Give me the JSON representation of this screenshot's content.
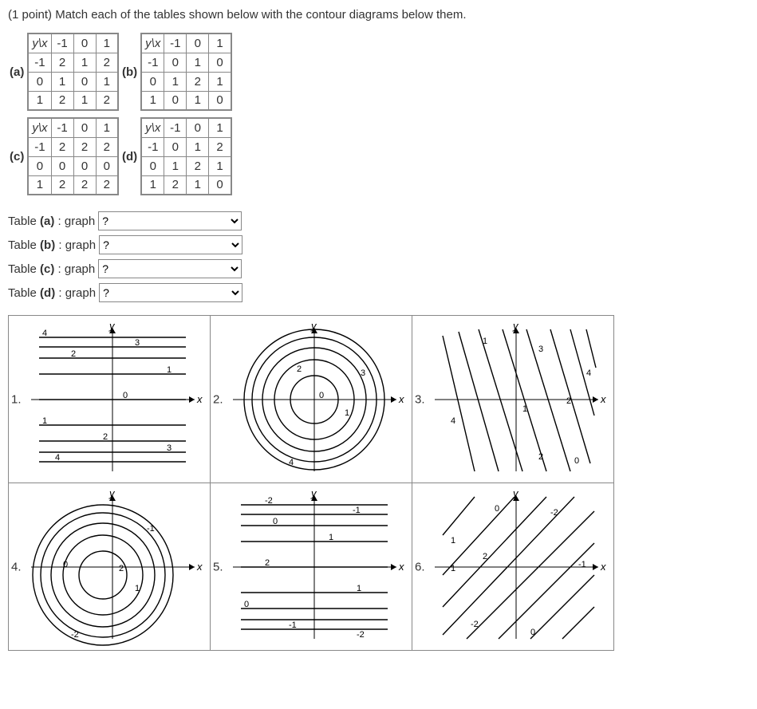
{
  "prompt_prefix": "(1 point) ",
  "prompt_body": "Match each of the tables shown below with the contour diagrams below them.",
  "yx": "y\\x",
  "tables": {
    "a": {
      "label": "(a)",
      "header": [
        "-1",
        "0",
        "1"
      ],
      "rows": [
        [
          "-1",
          "2",
          "1",
          "2"
        ],
        [
          "0",
          "1",
          "0",
          "1"
        ],
        [
          "1",
          "2",
          "1",
          "2"
        ]
      ]
    },
    "b": {
      "label": "(b)",
      "header": [
        "-1",
        "0",
        "1"
      ],
      "rows": [
        [
          "-1",
          "0",
          "1",
          "0"
        ],
        [
          "0",
          "1",
          "2",
          "1"
        ],
        [
          "1",
          "0",
          "1",
          "0"
        ]
      ]
    },
    "c": {
      "label": "(c)",
      "header": [
        "-1",
        "0",
        "1"
      ],
      "rows": [
        [
          "-1",
          "2",
          "2",
          "2"
        ],
        [
          "0",
          "0",
          "0",
          "0"
        ],
        [
          "1",
          "2",
          "2",
          "2"
        ]
      ]
    },
    "d": {
      "label": "(d)",
      "header": [
        "-1",
        "0",
        "1"
      ],
      "rows": [
        [
          "-1",
          "0",
          "1",
          "2"
        ],
        [
          "0",
          "1",
          "2",
          "1"
        ],
        [
          "1",
          "2",
          "1",
          "0"
        ]
      ]
    }
  },
  "match": {
    "a": {
      "pre": "Table ",
      "bold": "(a)",
      "post": " : graph",
      "value": "?"
    },
    "b": {
      "pre": "Table ",
      "bold": "(b)",
      "post": " : graph",
      "value": "?"
    },
    "c": {
      "pre": "Table ",
      "bold": "(c)",
      "post": " : graph",
      "value": "?"
    },
    "d": {
      "pre": "Table ",
      "bold": "(d)",
      "post": " : graph",
      "value": "?"
    }
  },
  "axis": {
    "x": "x",
    "y": "y"
  },
  "graphs": {
    "g1": {
      "num": "1.",
      "levels": [
        "4",
        "2",
        "3",
        "1",
        "0",
        "1",
        "2",
        "3",
        "4"
      ]
    },
    "g2": {
      "num": "2.",
      "levels": [
        "2",
        "0",
        "3",
        "1",
        "4"
      ]
    },
    "g3": {
      "num": "3.",
      "levels": [
        "1",
        "3",
        "4",
        "1",
        "2",
        "4",
        "2",
        "0"
      ]
    },
    "g4": {
      "num": "4.",
      "levels": [
        "0",
        "-1",
        "2",
        "1",
        "-2"
      ]
    },
    "g5": {
      "num": "5.",
      "levels": [
        "-2",
        "-1",
        "0",
        "1",
        "2",
        "1",
        "0",
        "-1",
        "-2"
      ]
    },
    "g6": {
      "num": "6.",
      "levels": [
        "0",
        "-2",
        "1",
        "2",
        "-1",
        "1",
        "-2",
        "0"
      ]
    }
  },
  "chart_data": [
    {
      "type": "table",
      "name": "a",
      "x": [
        -1,
        0,
        1
      ],
      "y": [
        -1,
        0,
        1
      ],
      "z": [
        [
          2,
          1,
          2
        ],
        [
          1,
          0,
          1
        ],
        [
          2,
          1,
          2
        ]
      ]
    },
    {
      "type": "table",
      "name": "b",
      "x": [
        -1,
        0,
        1
      ],
      "y": [
        -1,
        0,
        1
      ],
      "z": [
        [
          0,
          1,
          0
        ],
        [
          1,
          2,
          1
        ],
        [
          0,
          1,
          0
        ]
      ]
    },
    {
      "type": "table",
      "name": "c",
      "x": [
        -1,
        0,
        1
      ],
      "y": [
        -1,
        0,
        1
      ],
      "z": [
        [
          2,
          2,
          2
        ],
        [
          0,
          0,
          0
        ],
        [
          2,
          2,
          2
        ]
      ]
    },
    {
      "type": "table",
      "name": "d",
      "x": [
        -1,
        0,
        1
      ],
      "y": [
        -1,
        0,
        1
      ],
      "z": [
        [
          0,
          1,
          2
        ],
        [
          1,
          2,
          1
        ],
        [
          2,
          1,
          0
        ]
      ]
    },
    {
      "type": "contour",
      "name": "1",
      "style": "horizontal-symmetric",
      "levels_top_to_bottom": [
        4,
        2,
        3,
        1,
        0,
        1,
        2,
        3,
        4
      ]
    },
    {
      "type": "contour",
      "name": "2",
      "style": "concentric-centered",
      "levels_in_to_out": [
        0,
        1,
        2,
        3,
        4
      ]
    },
    {
      "type": "contour",
      "name": "3",
      "style": "diagonal-down-right",
      "levels": [
        1,
        3,
        4,
        1,
        2,
        4,
        2,
        0
      ]
    },
    {
      "type": "contour",
      "name": "4",
      "style": "concentric-offset-left-down",
      "levels_out_to_in": [
        -2,
        -1,
        0,
        1,
        2
      ]
    },
    {
      "type": "contour",
      "name": "5",
      "style": "horizontal-symmetric",
      "levels_top_to_bottom": [
        -2,
        -1,
        0,
        1,
        2,
        1,
        0,
        -1,
        -2
      ]
    },
    {
      "type": "contour",
      "name": "6",
      "style": "diagonal-down-left",
      "levels": [
        0,
        -2,
        1,
        2,
        -1,
        1,
        -2,
        0
      ]
    }
  ]
}
